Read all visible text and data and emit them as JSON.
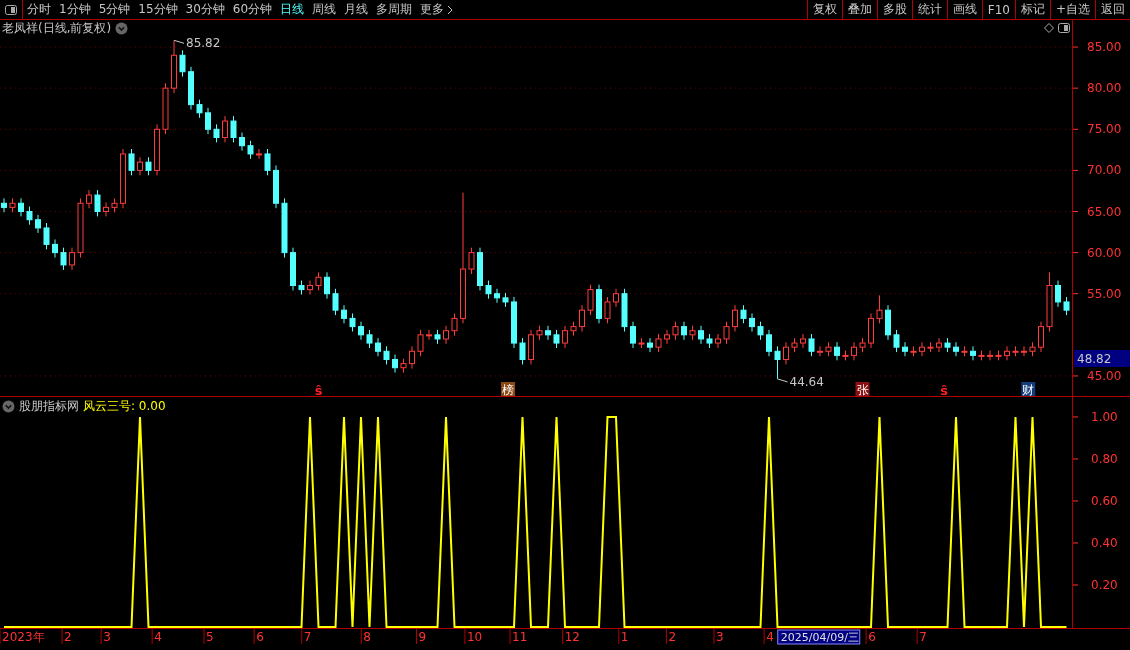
{
  "toolbar": {
    "periods": [
      {
        "label": "分时",
        "selected": false
      },
      {
        "label": "1分钟",
        "selected": false
      },
      {
        "label": "5分钟",
        "selected": false
      },
      {
        "label": "15分钟",
        "selected": false
      },
      {
        "label": "30分钟",
        "selected": false
      },
      {
        "label": "60分钟",
        "selected": false
      },
      {
        "label": "日线",
        "selected": true
      },
      {
        "label": "周线",
        "selected": false
      },
      {
        "label": "月线",
        "selected": false
      },
      {
        "label": "多周期",
        "selected": false
      }
    ],
    "more": "更多",
    "actions": [
      "复权",
      "叠加",
      "多股",
      "统计",
      "画线",
      "F10",
      "标记",
      "+自选",
      "返回"
    ]
  },
  "price_pane": {
    "title": "老凤祥(日线,前复权)",
    "chart_data": {
      "type": "candlestick",
      "grid": true,
      "ylim": [
        42.44,
        88.29
      ],
      "ohlc": [
        [
          66,
          66.6,
          64.9,
          65.5
        ],
        [
          65.5,
          66.6,
          64.9,
          66
        ],
        [
          66,
          66.6,
          64.4,
          65
        ],
        [
          65,
          65.6,
          63.4,
          64
        ],
        [
          64,
          64.6,
          62.4,
          63
        ],
        [
          63,
          63.6,
          60.4,
          61
        ],
        [
          61,
          61.6,
          59.4,
          60
        ],
        [
          60,
          60.6,
          57.9,
          58.5
        ],
        [
          58.5,
          60.6,
          57.9,
          60
        ],
        [
          60,
          66.6,
          59.4,
          66
        ],
        [
          66,
          67.6,
          65.4,
          67
        ],
        [
          67,
          67.6,
          64.4,
          65
        ],
        [
          65,
          66.1,
          64.4,
          65.5
        ],
        [
          65.5,
          66.6,
          64.9,
          66
        ],
        [
          66,
          72.6,
          65.4,
          72
        ],
        [
          72,
          72.6,
          69.4,
          70
        ],
        [
          70,
          71.6,
          69.4,
          71
        ],
        [
          71,
          71.6,
          69.4,
          70
        ],
        [
          70,
          75.6,
          69.4,
          75
        ],
        [
          75,
          80.6,
          74.4,
          80
        ],
        [
          80,
          85.82,
          79.4,
          84
        ],
        [
          84,
          84.6,
          81.4,
          82
        ],
        [
          82,
          82.6,
          77.4,
          78
        ],
        [
          78,
          78.6,
          76.4,
          77
        ],
        [
          77,
          77.6,
          74.4,
          75
        ],
        [
          75,
          75.6,
          73.4,
          74
        ],
        [
          74,
          76.6,
          73.4,
          76
        ],
        [
          76,
          76.6,
          73.4,
          74
        ],
        [
          74,
          74.6,
          72.4,
          73
        ],
        [
          73,
          73.6,
          71.4,
          72
        ],
        [
          72,
          72.6,
          71.4,
          72
        ],
        [
          72,
          72.6,
          69.4,
          70
        ],
        [
          70,
          70.6,
          65.4,
          66
        ],
        [
          66,
          66.6,
          59.4,
          60
        ],
        [
          60,
          60.6,
          55.4,
          56
        ],
        [
          56,
          56.6,
          54.9,
          55.5
        ],
        [
          55.5,
          56.6,
          54.9,
          56
        ],
        [
          56,
          57.6,
          55.4,
          57
        ],
        [
          57,
          57.6,
          54.4,
          55
        ],
        [
          55,
          55.6,
          52.4,
          53
        ],
        [
          53,
          53.6,
          51.4,
          52
        ],
        [
          52,
          52.6,
          50.4,
          51
        ],
        [
          51,
          51.6,
          49.4,
          50
        ],
        [
          50,
          50.6,
          48.4,
          49
        ],
        [
          49,
          49.6,
          47.4,
          48
        ],
        [
          48,
          48.6,
          46.4,
          47
        ],
        [
          47,
          47.6,
          45.4,
          46
        ],
        [
          46,
          47.1,
          45.4,
          46.5
        ],
        [
          46.5,
          48.6,
          45.9,
          48
        ],
        [
          48,
          50.6,
          47.4,
          50
        ],
        [
          50,
          50.6,
          49.4,
          50
        ],
        [
          50,
          50.6,
          48.9,
          49.5
        ],
        [
          49.5,
          51.1,
          48.9,
          50.5
        ],
        [
          50.5,
          52.6,
          49.9,
          52
        ],
        [
          52,
          67.3,
          51.4,
          58
        ],
        [
          58,
          60.6,
          57.4,
          60
        ],
        [
          60,
          60.6,
          55.4,
          56
        ],
        [
          56,
          56.6,
          54.4,
          55
        ],
        [
          55,
          55.6,
          53.9,
          54.5
        ],
        [
          54.5,
          55.1,
          53.4,
          54
        ],
        [
          54,
          54.6,
          48.4,
          49
        ],
        [
          49,
          49.6,
          46.4,
          47
        ],
        [
          47,
          50.6,
          46.4,
          50
        ],
        [
          50,
          51.1,
          49.4,
          50.5
        ],
        [
          50.5,
          51.1,
          49.4,
          50
        ],
        [
          50,
          50.6,
          48.4,
          49
        ],
        [
          49,
          51.1,
          48.4,
          50.5
        ],
        [
          50.5,
          51.6,
          49.9,
          51
        ],
        [
          51,
          53.6,
          50.4,
          53
        ],
        [
          53,
          56.1,
          52.4,
          55.5
        ],
        [
          55.5,
          56.1,
          51.4,
          52
        ],
        [
          52,
          54.6,
          51.4,
          54
        ],
        [
          54,
          55.6,
          53.4,
          55
        ],
        [
          55,
          55.6,
          50.4,
          51
        ],
        [
          51,
          51.6,
          48.4,
          49
        ],
        [
          49,
          49.6,
          48.4,
          49
        ],
        [
          49,
          49.6,
          47.9,
          48.5
        ],
        [
          48.5,
          50.1,
          47.9,
          49.5
        ],
        [
          49.5,
          50.6,
          48.9,
          50
        ],
        [
          50,
          51.6,
          49.4,
          51
        ],
        [
          51,
          51.6,
          49.4,
          50
        ],
        [
          50,
          51.1,
          49.4,
          50.5
        ],
        [
          50.5,
          51.1,
          48.9,
          49.5
        ],
        [
          49.5,
          50.1,
          48.4,
          49
        ],
        [
          49,
          50.1,
          48.4,
          49.5
        ],
        [
          49.5,
          51.6,
          48.9,
          51
        ],
        [
          51,
          53.6,
          50.4,
          53
        ],
        [
          53,
          53.6,
          51.4,
          52
        ],
        [
          52,
          52.6,
          50.4,
          51
        ],
        [
          51,
          51.6,
          49.4,
          50
        ],
        [
          50,
          50.6,
          47.4,
          48
        ],
        [
          48,
          48.6,
          44.64,
          47
        ],
        [
          47,
          49.1,
          46.4,
          48.5
        ],
        [
          48.5,
          49.6,
          47.9,
          49
        ],
        [
          49,
          50.1,
          48.4,
          49.5
        ],
        [
          49.5,
          50.1,
          47.4,
          48
        ],
        [
          48,
          48.6,
          47.4,
          48
        ],
        [
          48,
          49.1,
          47.4,
          48.5
        ],
        [
          48.5,
          49.1,
          46.9,
          47.5
        ],
        [
          47.5,
          48.1,
          46.9,
          47.5
        ],
        [
          47.5,
          49.1,
          46.9,
          48.5
        ],
        [
          48.5,
          49.6,
          47.9,
          49
        ],
        [
          49,
          52.6,
          48.4,
          52
        ],
        [
          52,
          54.8,
          51.4,
          53
        ],
        [
          53,
          53.6,
          49.4,
          50
        ],
        [
          50,
          50.6,
          47.9,
          48.5
        ],
        [
          48.5,
          49.1,
          47.4,
          48
        ],
        [
          48,
          48.6,
          47.4,
          48
        ],
        [
          48,
          49.1,
          47.4,
          48.5
        ],
        [
          48.5,
          49.1,
          47.9,
          48.5
        ],
        [
          48.5,
          49.6,
          47.9,
          49
        ],
        [
          49,
          49.6,
          47.9,
          48.5
        ],
        [
          48.5,
          49.1,
          47.4,
          48
        ],
        [
          48,
          48.6,
          47.4,
          48
        ],
        [
          48,
          48.6,
          46.9,
          47.5
        ],
        [
          47.5,
          48.1,
          46.9,
          47.5
        ],
        [
          47.5,
          48.1,
          46.9,
          47.5
        ],
        [
          47.5,
          48.1,
          46.9,
          47.5
        ],
        [
          47.5,
          48.6,
          46.9,
          48
        ],
        [
          48,
          48.6,
          47.4,
          48
        ],
        [
          48,
          48.6,
          47.4,
          48
        ],
        [
          48,
          49.1,
          47.4,
          48.5
        ],
        [
          48.5,
          51.6,
          47.9,
          51
        ],
        [
          51,
          57.6,
          50.4,
          56
        ],
        [
          56,
          56.6,
          53.4,
          54
        ],
        [
          54,
          54.6,
          52.4,
          53
        ]
      ],
      "yticks": [
        {
          "value": 85,
          "label": "85.00"
        },
        {
          "value": 80,
          "label": "80.00"
        },
        {
          "value": 75,
          "label": "75.00"
        },
        {
          "value": 70,
          "label": "70.00"
        },
        {
          "value": 65,
          "label": "65.00"
        },
        {
          "value": 60,
          "label": "60.00"
        },
        {
          "value": 55,
          "label": "55.00"
        },
        {
          "value": 45,
          "label": "45.00"
        }
      ],
      "annotations": [
        "85.82",
        "44.64"
      ]
    },
    "last_price": "48.82",
    "markers": [
      {
        "kind": "text",
        "label": "ŝ",
        "color": "#ff2020"
      },
      {
        "kind": "tag",
        "label": "榜",
        "color": "#8b4a14"
      },
      {
        "kind": "tag",
        "label": "张",
        "color": "#8b1010"
      },
      {
        "kind": "text",
        "label": "ŝ",
        "color": "#ff2020"
      },
      {
        "kind": "tag",
        "label": "财",
        "color": "#123c7a"
      }
    ]
  },
  "indicator_pane": {
    "source": "股朋指标网",
    "reading": "风云三号: 0.00",
    "chart_data": {
      "type": "line",
      "ylim": [
        0,
        1.095
      ],
      "series": [
        {
          "color": "#ffff00",
          "values": [
            0,
            0,
            0,
            0,
            0,
            0,
            0,
            0,
            0,
            0,
            0,
            0,
            0,
            0,
            0,
            0,
            1,
            0,
            0,
            0,
            0,
            0,
            0,
            0,
            0,
            0,
            0,
            0,
            0,
            0,
            0,
            0,
            0,
            0,
            0,
            0,
            1,
            0,
            0,
            0,
            1,
            0,
            1,
            0,
            1,
            0,
            0,
            0,
            0,
            0,
            0,
            0,
            1,
            0,
            0,
            0,
            0,
            0,
            0,
            0,
            0,
            1,
            0,
            0,
            0,
            1,
            0,
            0,
            0,
            0,
            0,
            1,
            1,
            0,
            0,
            0,
            0,
            0,
            0,
            0,
            0,
            0,
            0,
            0,
            0,
            0,
            0,
            0,
            0,
            0,
            1,
            0,
            0,
            0,
            0,
            0,
            0,
            0,
            0,
            0,
            0,
            0,
            0,
            1,
            0,
            0,
            0,
            0,
            0,
            0,
            0,
            0,
            1,
            0,
            0,
            0,
            0,
            0,
            0,
            1,
            0,
            1,
            0,
            0,
            0,
            0
          ]
        }
      ],
      "yticks": [
        {
          "value": 1,
          "label": "1.00"
        },
        {
          "value": 0.8,
          "label": "0.80"
        },
        {
          "value": 0.6,
          "label": "0.60"
        },
        {
          "value": 0.4,
          "label": "0.40"
        },
        {
          "value": 0.2,
          "label": "0.20"
        }
      ]
    }
  },
  "time_axis": {
    "labels": [
      "2023年",
      "2",
      "3",
      "4",
      "5",
      "6",
      "7",
      "8",
      "9",
      "10",
      "11",
      "12",
      "1",
      "2",
      "3",
      "4"
    ],
    "cursor_date": "2025/04/09/三",
    "labels_after": [
      "6",
      "7"
    ]
  }
}
